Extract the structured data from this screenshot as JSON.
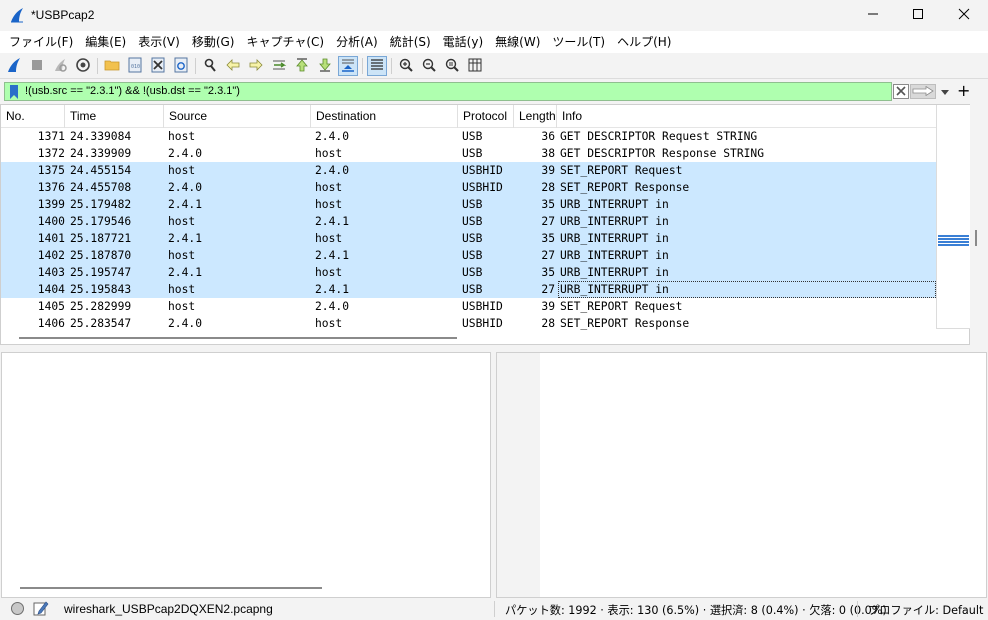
{
  "window": {
    "title": "*USBPcap2",
    "minimize_icon": "minimize-icon",
    "maximize_icon": "maximize-icon",
    "close_icon": "close-icon"
  },
  "menu": [
    "ファイル(F)",
    "編集(E)",
    "表示(V)",
    "移動(G)",
    "キャプチャ(C)",
    "分析(A)",
    "統計(S)",
    "電話(y)",
    "無線(W)",
    "ツール(T)",
    "ヘルプ(H)"
  ],
  "toolbar": {
    "icons": [
      "start-capture-icon",
      "stop-capture-icon",
      "restart-capture-icon",
      "capture-options-icon",
      "open-file-icon",
      "save-file-icon",
      "close-file-icon",
      "reload-file-icon",
      "find-packet-icon",
      "go-back-icon",
      "go-forward-icon",
      "go-to-packet-icon",
      "go-first-icon",
      "go-last-icon",
      "autoscroll-icon",
      "colorize-icon",
      "zoom-in-icon",
      "zoom-out-icon",
      "zoom-normal-icon",
      "resize-columns-icon"
    ]
  },
  "filter": {
    "value": "!(usb.src == \"2.3.1\") && !(usb.dst == \"2.3.1\")",
    "background": "#afffaf"
  },
  "packet_list": {
    "columns": [
      "No.",
      "Time",
      "Source",
      "Destination",
      "Protocol",
      "Length",
      "Info"
    ],
    "rows": [
      {
        "no": "1371",
        "time": "24.339084",
        "src": "host",
        "dst": "2.4.0",
        "proto": "USB",
        "len": "36",
        "info": "GET DESCRIPTOR Request STRING",
        "selected": false
      },
      {
        "no": "1372",
        "time": "24.339909",
        "src": "2.4.0",
        "dst": "host",
        "proto": "USB",
        "len": "38",
        "info": "GET DESCRIPTOR Response STRING",
        "selected": false
      },
      {
        "no": "1375",
        "time": "24.455154",
        "src": "host",
        "dst": "2.4.0",
        "proto": "USBHID",
        "len": "39",
        "info": "SET_REPORT Request",
        "selected": true
      },
      {
        "no": "1376",
        "time": "24.455708",
        "src": "2.4.0",
        "dst": "host",
        "proto": "USBHID",
        "len": "28",
        "info": "SET_REPORT Response",
        "selected": true
      },
      {
        "no": "1399",
        "time": "25.179482",
        "src": "2.4.1",
        "dst": "host",
        "proto": "USB",
        "len": "35",
        "info": "URB_INTERRUPT in",
        "selected": true
      },
      {
        "no": "1400",
        "time": "25.179546",
        "src": "host",
        "dst": "2.4.1",
        "proto": "USB",
        "len": "27",
        "info": "URB_INTERRUPT in",
        "selected": true
      },
      {
        "no": "1401",
        "time": "25.187721",
        "src": "2.4.1",
        "dst": "host",
        "proto": "USB",
        "len": "35",
        "info": "URB_INTERRUPT in",
        "selected": true
      },
      {
        "no": "1402",
        "time": "25.187870",
        "src": "host",
        "dst": "2.4.1",
        "proto": "USB",
        "len": "27",
        "info": "URB_INTERRUPT in",
        "selected": true
      },
      {
        "no": "1403",
        "time": "25.195747",
        "src": "2.4.1",
        "dst": "host",
        "proto": "USB",
        "len": "35",
        "info": "URB_INTERRUPT in",
        "selected": true
      },
      {
        "no": "1404",
        "time": "25.195843",
        "src": "host",
        "dst": "2.4.1",
        "proto": "USB",
        "len": "27",
        "info": "URB_INTERRUPT in",
        "selected": true,
        "focused": true
      },
      {
        "no": "1405",
        "time": "25.282999",
        "src": "host",
        "dst": "2.4.0",
        "proto": "USBHID",
        "len": "39",
        "info": "SET_REPORT Request",
        "selected": false
      },
      {
        "no": "1406",
        "time": "25.283547",
        "src": "2.4.0",
        "dst": "host",
        "proto": "USBHID",
        "len": "28",
        "info": "SET_REPORT Response",
        "selected": false
      }
    ],
    "selection_color": "#cce8ff"
  },
  "status": {
    "file": "wireshark_USBPcap2DQXEN2.pcapng",
    "stats": "パケット数: 1992 · 表示: 130 (6.5%) · 選択済: 8 (0.4%) · 欠落: 0 (0.0%)",
    "profile": "プロファイル: Default"
  }
}
